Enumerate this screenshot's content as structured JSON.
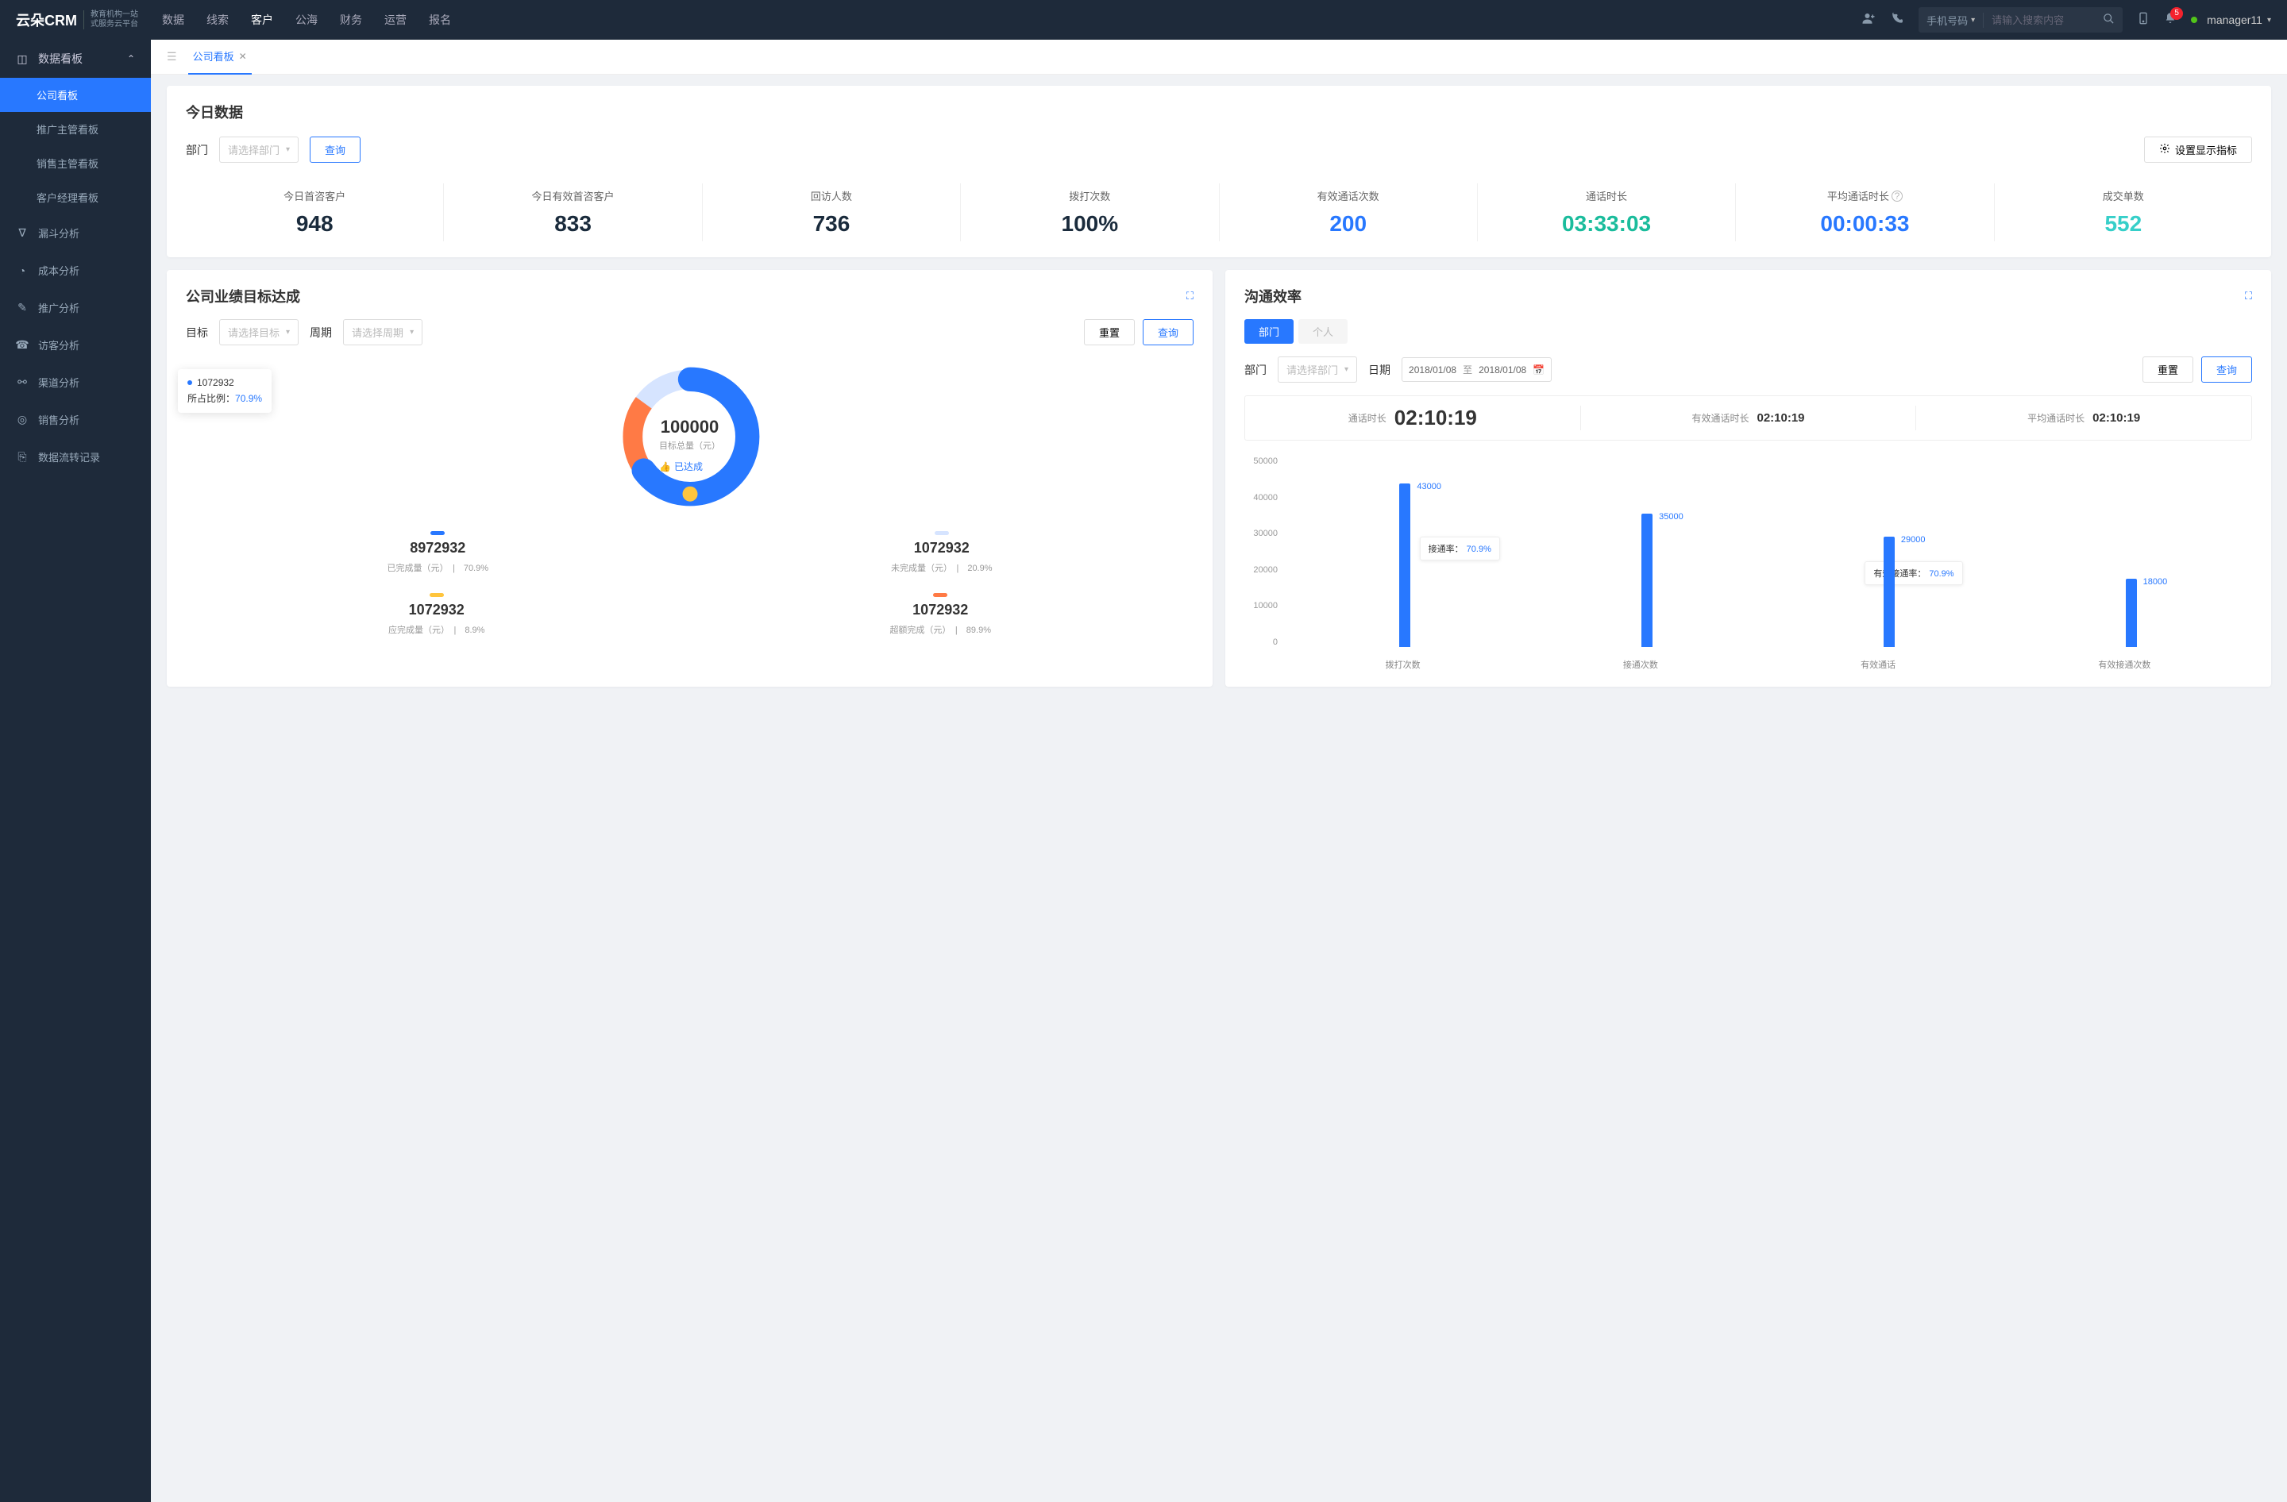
{
  "header": {
    "logo_main": "云朵CRM",
    "logo_sub_url": "www.yunduocrm.com",
    "logo_caption1": "教育机构一站",
    "logo_caption2": "式服务云平台",
    "nav": [
      "数据",
      "线索",
      "客户",
      "公海",
      "财务",
      "运营",
      "报名"
    ],
    "active_nav_index": 2,
    "search_type": "手机号码",
    "search_placeholder": "请输入搜索内容",
    "badge_count": "5",
    "username": "manager11"
  },
  "sidebar": {
    "group_label": "数据看板",
    "subs": [
      "公司看板",
      "推广主管看板",
      "销售主管看板",
      "客户经理看板"
    ],
    "active_sub_index": 0,
    "items": [
      "漏斗分析",
      "成本分析",
      "推广分析",
      "访客分析",
      "渠道分析",
      "销售分析",
      "数据流转记录"
    ]
  },
  "tabs": {
    "current": "公司看板"
  },
  "today": {
    "title": "今日数据",
    "dept_label": "部门",
    "dept_placeholder": "请选择部门",
    "query_btn": "查询",
    "settings_btn": "设置显示指标",
    "metrics": [
      {
        "label": "今日首咨客户",
        "value": "948",
        "cls": "c-dark"
      },
      {
        "label": "今日有效首咨客户",
        "value": "833",
        "cls": "c-dark"
      },
      {
        "label": "回访人数",
        "value": "736",
        "cls": "c-dark"
      },
      {
        "label": "拨打次数",
        "value": "100%",
        "cls": "c-dark"
      },
      {
        "label": "有效通话次数",
        "value": "200",
        "cls": "c-blue"
      },
      {
        "label": "通话时长",
        "value": "03:33:03",
        "cls": "c-teal"
      },
      {
        "label": "平均通话时长",
        "value": "00:00:33",
        "cls": "c-blue",
        "info": true
      },
      {
        "label": "成交单数",
        "value": "552",
        "cls": "c-cyan"
      }
    ]
  },
  "achievement": {
    "title": "公司业绩目标达成",
    "target_label": "目标",
    "target_placeholder": "请选择目标",
    "period_label": "周期",
    "period_placeholder": "请选择周期",
    "reset_btn": "重置",
    "query_btn": "查询",
    "center_value": "100000",
    "center_sub": "目标总量（元）",
    "achieved_label": "已达成",
    "tooltip_value": "1072932",
    "tooltip_ratio_label": "所占比例：",
    "tooltip_ratio": "70.9%",
    "legends": [
      {
        "color": "#2878ff",
        "value": "8972932",
        "sub": "已完成量（元）",
        "pct": "70.9%"
      },
      {
        "color": "#d6e4ff",
        "value": "1072932",
        "sub": "未完成量（元）",
        "pct": "20.9%"
      },
      {
        "color": "#ffc53d",
        "value": "1072932",
        "sub": "应完成量（元）",
        "pct": "8.9%"
      },
      {
        "color": "#ff7a45",
        "value": "1072932",
        "sub": "超额完成（元）",
        "pct": "89.9%"
      }
    ]
  },
  "efficiency": {
    "title": "沟通效率",
    "tab_dept": "部门",
    "tab_person": "个人",
    "dept_label": "部门",
    "dept_placeholder": "请选择部门",
    "date_label": "日期",
    "date_start": "2018/01/08",
    "date_to": "至",
    "date_end": "2018/01/08",
    "reset_btn": "重置",
    "query_btn": "查询",
    "stats": [
      {
        "label": "通话时长",
        "value": "02:10:19",
        "big": true
      },
      {
        "label": "有效通话时长",
        "value": "02:10:19",
        "big": false
      },
      {
        "label": "平均通话时长",
        "value": "02:10:19",
        "big": false
      }
    ],
    "callout1_label": "接通率：",
    "callout1_pct": "70.9%",
    "callout2_label": "有效接通率：",
    "callout2_pct": "70.9%"
  },
  "chart_data": [
    {
      "type": "pie",
      "title": "公司业绩目标达成",
      "center_label": "目标总量（元）",
      "center_value": 100000,
      "series": [
        {
          "name": "已完成量（元）",
          "value": 8972932,
          "pct": 70.9,
          "color": "#2878ff"
        },
        {
          "name": "未完成量（元）",
          "value": 1072932,
          "pct": 20.9,
          "color": "#d6e4ff"
        },
        {
          "name": "应完成量（元）",
          "value": 1072932,
          "pct": 8.9,
          "color": "#ffc53d"
        },
        {
          "name": "超额完成（元）",
          "value": 1072932,
          "pct": 89.9,
          "color": "#ff7a45"
        }
      ]
    },
    {
      "type": "bar",
      "title": "沟通效率",
      "ylabel": "",
      "ylim": [
        0,
        50000
      ],
      "categories": [
        "拨打次数",
        "接通次数",
        "有效通话",
        "有效接通次数"
      ],
      "values": [
        43000,
        35000,
        29000,
        18000
      ],
      "annotations": [
        {
          "text": "接通率：70.9%",
          "between": [
            "拨打次数",
            "接通次数"
          ]
        },
        {
          "text": "有效接通率：70.9%",
          "between": [
            "有效通话",
            "有效接通次数"
          ]
        }
      ]
    }
  ]
}
